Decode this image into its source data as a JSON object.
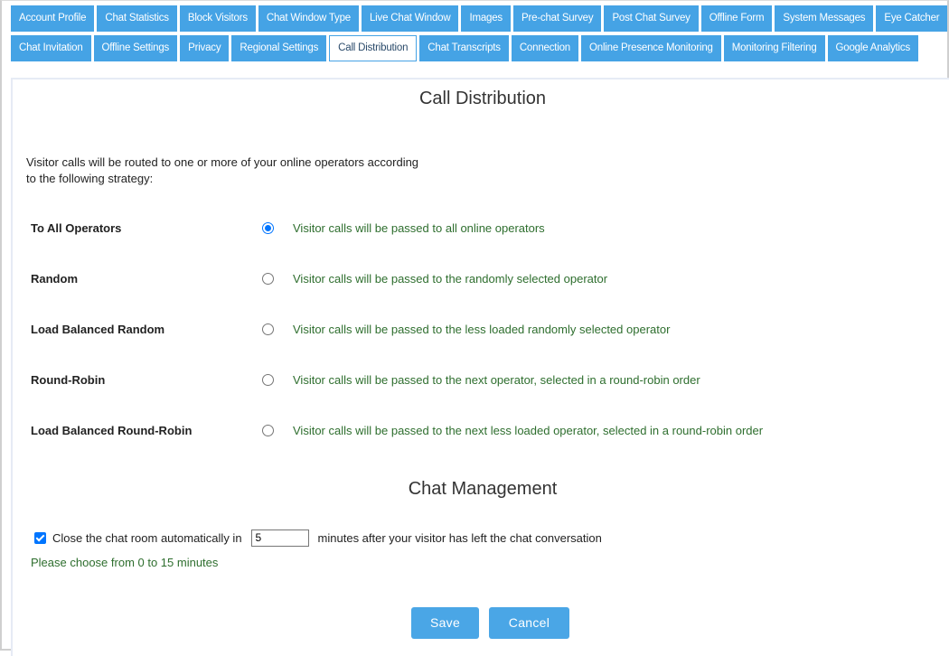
{
  "tabs": {
    "row1": [
      {
        "label": "Account Profile",
        "active": false
      },
      {
        "label": "Chat Statistics",
        "active": false
      },
      {
        "label": "Block Visitors",
        "active": false
      },
      {
        "label": "Chat Window Type",
        "active": false
      },
      {
        "label": "Live Chat Window",
        "active": false
      },
      {
        "label": "Images",
        "active": false
      },
      {
        "label": "Pre-chat Survey",
        "active": false
      },
      {
        "label": "Post Chat Survey",
        "active": false
      },
      {
        "label": "Offline Form",
        "active": false
      },
      {
        "label": "System Messages",
        "active": false
      },
      {
        "label": "Eye Catcher",
        "active": false
      }
    ],
    "row2": [
      {
        "label": "Chat Invitation",
        "active": false
      },
      {
        "label": "Offline Settings",
        "active": false
      },
      {
        "label": "Privacy",
        "active": false
      },
      {
        "label": "Regional Settings",
        "active": false
      },
      {
        "label": "Call Distribution",
        "active": true
      },
      {
        "label": "Chat Transcripts",
        "active": false
      },
      {
        "label": "Connection",
        "active": false
      },
      {
        "label": "Online Presence Monitoring",
        "active": false
      },
      {
        "label": "Monitoring Filtering",
        "active": false
      },
      {
        "label": "Google Analytics",
        "active": false
      }
    ]
  },
  "call_distribution": {
    "title": "Call Distribution",
    "intro": "Visitor calls will be routed to one or more of your online operators according to the following strategy:",
    "options": [
      {
        "label": "To All Operators",
        "description": "Visitor calls will be passed to all online operators",
        "selected": true
      },
      {
        "label": "Random",
        "description": "Visitor calls will be passed to the randomly selected operator",
        "selected": false
      },
      {
        "label": "Load Balanced Random",
        "description": "Visitor calls will be passed to the less loaded randomly selected operator",
        "selected": false
      },
      {
        "label": "Round-Robin",
        "description": "Visitor calls will be passed to the next operator, selected in a round-robin order",
        "selected": false
      },
      {
        "label": "Load Balanced Round-Robin",
        "description": "Visitor calls will be passed to the next less loaded operator, selected in a round-robin order",
        "selected": false
      }
    ]
  },
  "chat_management": {
    "title": "Chat Management",
    "auto_close_checked": true,
    "auto_close_label_before": "Close the chat room automatically in",
    "auto_close_minutes": "5",
    "auto_close_label_after": "minutes after your visitor has left the chat conversation",
    "hint": "Please choose from 0 to 15 minutes"
  },
  "buttons": {
    "save": "Save",
    "cancel": "Cancel"
  },
  "colors": {
    "tab_bg": "#45a3e5",
    "button_bg": "#4aa6e6",
    "description_text": "#2e6e2e",
    "radio_checked": "#0075ff"
  }
}
